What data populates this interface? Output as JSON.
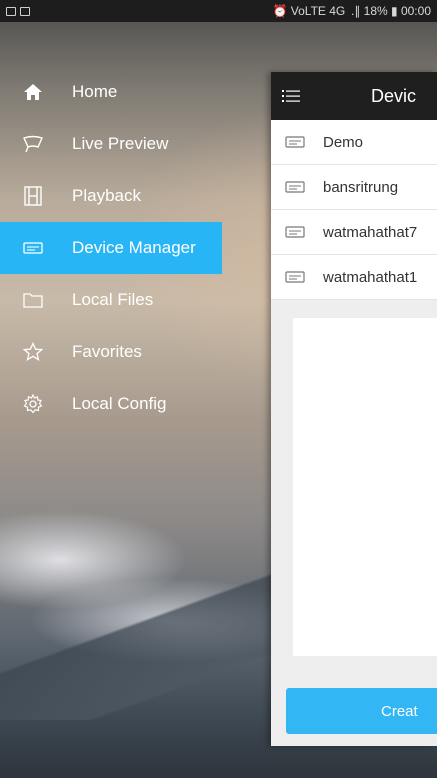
{
  "status_bar": {
    "right_text": "⏰ VoLTE 4G  .∥ 18% ▮ 00:00"
  },
  "drawer": {
    "items": [
      {
        "label": "Home",
        "icon": "home-icon"
      },
      {
        "label": "Live Preview",
        "icon": "live-preview-icon"
      },
      {
        "label": "Playback",
        "icon": "playback-icon"
      },
      {
        "label": "Device Manager",
        "icon": "device-manager-icon",
        "active": true
      },
      {
        "label": "Local Files",
        "icon": "folder-icon"
      },
      {
        "label": "Favorites",
        "icon": "star-icon"
      },
      {
        "label": "Local Config",
        "icon": "gear-icon"
      }
    ],
    "active_color": "#28b5f5"
  },
  "panel": {
    "title": "Devic",
    "devices": [
      "Demo",
      "bansritrung",
      "watmahathat7",
      "watmahathat1"
    ],
    "create_label": "Creat"
  }
}
